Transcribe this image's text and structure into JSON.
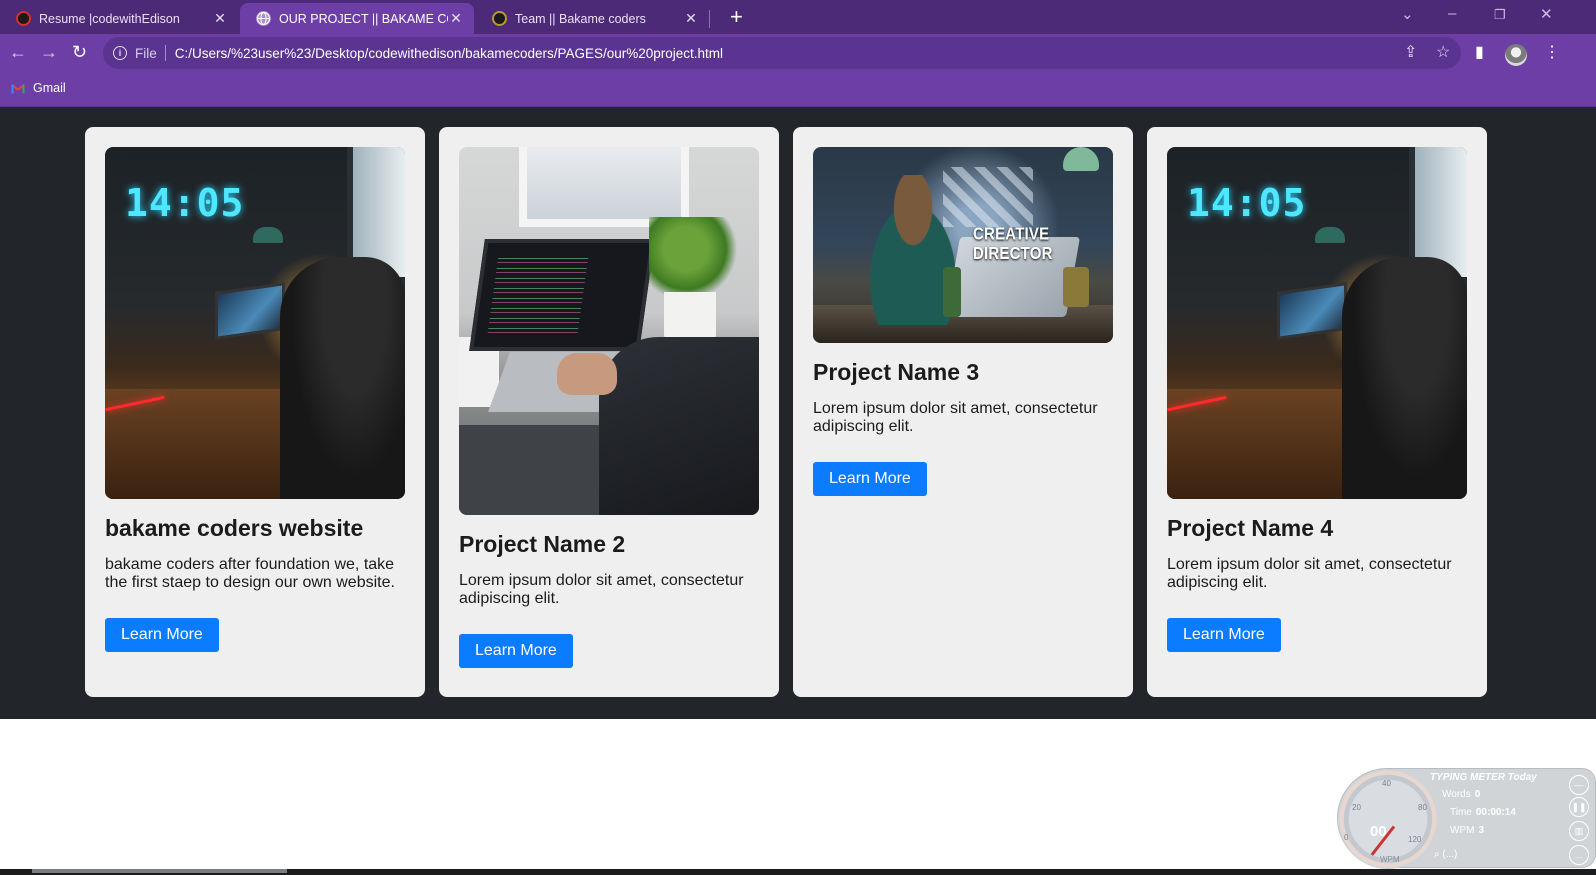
{
  "browser": {
    "tabs": [
      {
        "title": "Resume |codewithEdison",
        "active": false
      },
      {
        "title": "OUR PROJECT || BAKAME CODERS",
        "active": true
      },
      {
        "title": "Team || Bakame coders",
        "active": false
      }
    ],
    "new_tab_symbol": "+",
    "address": {
      "scheme_label": "File",
      "url": "C:/Users/%23user%23/Desktop/codewithedison/bakamecoders/PAGES/our%20project.html"
    },
    "bookmarks": [
      {
        "label": "Gmail"
      }
    ]
  },
  "projects": [
    {
      "title": "bakame coders website",
      "description": "bakame coders after foundation we, take the first staep to design our own website.",
      "button": "Learn More"
    },
    {
      "title": "Project Name 2",
      "description": "Lorem ipsum dolor sit amet, consectetur adipiscing elit.",
      "button": "Learn More"
    },
    {
      "title": "Project Name 3",
      "description": "Lorem ipsum dolor sit amet, consectetur adipiscing elit.",
      "button": "Learn More",
      "image_caption": "CREATIVE DIRECTOR"
    },
    {
      "title": "Project Name 4",
      "description": "Lorem ipsum dolor sit amet, consectetur adipiscing elit.",
      "button": "Learn More"
    }
  ],
  "typing_meter": {
    "title": "TYPING METER Today",
    "words_label": "Words",
    "words_value": "0",
    "time_label": "Time",
    "time_value": "00:00:14",
    "wpm_label": "WPM",
    "wpm_value": "3",
    "dial_value": "00",
    "dial_unit": "WPM",
    "dial_ticks": [
      "0",
      "20",
      "40",
      "80",
      "120"
    ],
    "search_text": "(...)"
  },
  "colors": {
    "tab_strip": "#4d2a78",
    "toolbar": "#6d3fa6",
    "page_background": "#22262b",
    "card_background": "#efefef",
    "button": "#0b7cff"
  }
}
